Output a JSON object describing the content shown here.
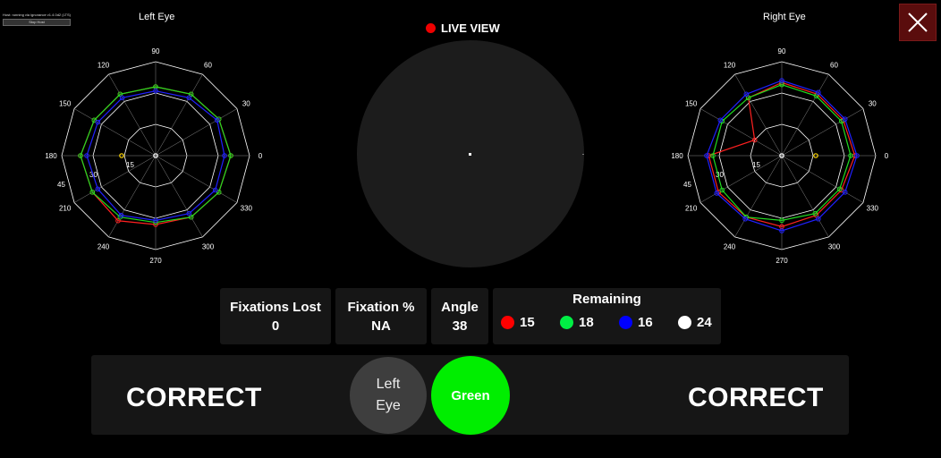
{
  "host": {
    "status": "Host: running via ignorance v1.4.0d2 (LTS)",
    "stop_label": "Stop Host"
  },
  "left_eye": {
    "title": "Left Eye",
    "angle_labels": [
      "90",
      "60",
      "30",
      "0",
      "330",
      "300",
      "270",
      "240",
      "210",
      "180",
      "150",
      "120"
    ],
    "ring_labels": [
      "45",
      "30",
      "15"
    ],
    "series": [
      {
        "color": "#ff2020",
        "radii": [
          33,
          34,
          35,
          36,
          35,
          34,
          33,
          36,
          35,
          36,
          34,
          34
        ]
      },
      {
        "color": "#20dd20",
        "radii": [
          33,
          34,
          35,
          36,
          35,
          34,
          32,
          34,
          35,
          36,
          34,
          34
        ]
      },
      {
        "color": "#2020ff",
        "radii": [
          31,
          32,
          34,
          33,
          33,
          32,
          31,
          33,
          32,
          33,
          32,
          32
        ]
      }
    ]
  },
  "right_eye": {
    "title": "Right Eye",
    "angle_labels": [
      "90",
      "60",
      "30",
      "0",
      "330",
      "300",
      "270",
      "240",
      "210",
      "180",
      "150",
      "120"
    ],
    "ring_labels": [
      "45",
      "30",
      "15"
    ],
    "series": [
      {
        "color": "#ff2020",
        "radii": [
          35,
          34,
          34,
          35,
          33,
          33,
          34,
          34,
          35,
          35,
          15,
          32
        ]
      },
      {
        "color": "#20dd20",
        "radii": [
          34,
          33,
          33,
          33,
          32,
          32,
          31,
          34,
          33,
          33,
          33,
          32
        ]
      },
      {
        "color": "#2020ff",
        "radii": [
          36,
          35,
          35,
          36,
          35,
          35,
          36,
          35,
          36,
          36,
          34,
          34
        ]
      }
    ]
  },
  "live_view": {
    "label": "LIVE VIEW"
  },
  "stats": {
    "fixations_lost_label": "Fixations Lost",
    "fixations_lost_value": "0",
    "fixation_pct_label": "Fixation %",
    "fixation_pct_value": "NA",
    "angle_label": "Angle",
    "angle_value": "38"
  },
  "remaining": {
    "title": "Remaining",
    "items": [
      {
        "color": "#ff0000",
        "value": "15"
      },
      {
        "color": "#00ee44",
        "value": "18"
      },
      {
        "color": "#0000ff",
        "value": "16"
      },
      {
        "color": "#ffffff",
        "value": "24"
      }
    ]
  },
  "controls": {
    "left_correct": "CORRECT",
    "right_correct": "CORRECT",
    "eye_line1": "Left",
    "eye_line2": "Eye",
    "green_label": "Green"
  }
}
